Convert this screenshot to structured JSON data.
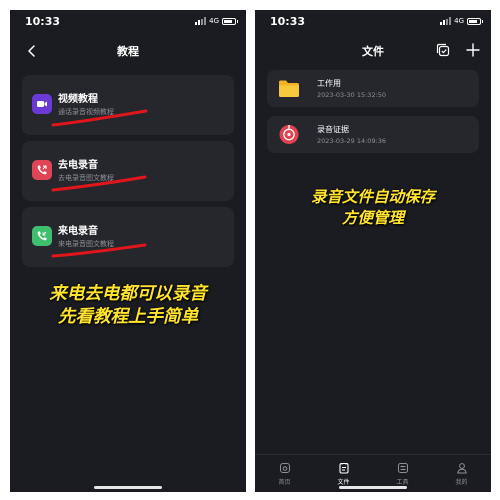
{
  "left_phone": {
    "status": {
      "time": "10:33",
      "network": "4G"
    },
    "nav": {
      "title": "教程"
    },
    "tutorials": [
      {
        "title": "视频教程",
        "subtitle": "通话录音视频教程",
        "icon": "video-icon",
        "color": "#6b3ad6"
      },
      {
        "title": "去电录音",
        "subtitle": "去电录音图文教程",
        "icon": "phone-out-icon",
        "color": "#e04555"
      },
      {
        "title": "来电录音",
        "subtitle": "来电录音图文教程",
        "icon": "phone-in-icon",
        "color": "#3fbf6e"
      }
    ],
    "overlay": {
      "line1": "来电去电都可以录音",
      "line2": "先看教程上手简单"
    }
  },
  "right_phone": {
    "status": {
      "time": "10:33",
      "network": "4G"
    },
    "nav": {
      "title": "文件"
    },
    "files": [
      {
        "name": "工作用",
        "date": "2023-03-30 15:32:50",
        "icon": "folder-icon",
        "color": "#f6c02c"
      },
      {
        "name": "录音证据",
        "date": "2023-03-29 14:09:36",
        "icon": "record-icon",
        "color": "#e0434f"
      }
    ],
    "overlay": {
      "line1": "录音文件自动保存",
      "line2": "方便管理"
    },
    "tabs": [
      {
        "label": "首页",
        "icon": "home-icon",
        "active": false
      },
      {
        "label": "文件",
        "icon": "file-icon",
        "active": true
      },
      {
        "label": "工具",
        "icon": "tools-icon",
        "active": false
      },
      {
        "label": "我的",
        "icon": "user-icon",
        "active": false
      }
    ]
  },
  "colors": {
    "background": "#1b1c21",
    "card": "#26272d",
    "subtext": "#8d8f98",
    "annotation": "#e0161b",
    "overlay_text": "#ffe32d"
  }
}
